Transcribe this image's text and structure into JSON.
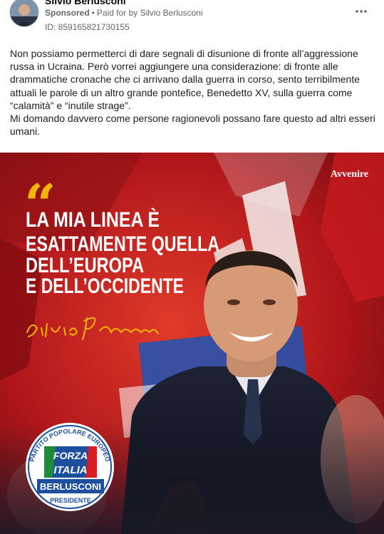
{
  "post": {
    "page_name": "Silvio Berlusconi",
    "sponsored_label": "Sponsored",
    "separator": "•",
    "paid_for_text": "Paid for by Silvio Berlusconi",
    "ad_id": "ID: 859165821730155",
    "more_icon": "more-horizontal-icon",
    "body_paragraphs": [
      "Non possiamo permetterci di dare segnali di disunione di fronte all’aggressione russa in Ucraina. Però vorrei aggiungere una considerazione: di fronte alle drammatiche cronache che ci arrivano dalla guerra in corso, sento terribilmente attuali le parole di un altro grande pontefice, Benedetto XV, sulla guerra come “calamità” e “inutile strage”.",
      "Mi domando davvero come persone ragionevoli possano fare questo ad altri esseri umani."
    ]
  },
  "creative": {
    "watermark": "Avvenire",
    "quote_mark": "“",
    "headline_lines": [
      "LA MIA LINEA È",
      "ESATTAMENTE QUELLA",
      "DELL’EUROPA",
      "E DELL’OCCIDENTE"
    ],
    "logo": {
      "ring_text": "PARTITO POPOLARE EUROPEO",
      "party_line_1": "FORZA",
      "party_line_2": "ITALIA",
      "leader": "BERLUSCONI",
      "role": "PRESIDENTE"
    },
    "signature_text": "Silvio Berlusconi",
    "colors": {
      "quote_yellow": "#f2b705",
      "headline_white": "#ffffff",
      "logo_blue": "#1d4f9e",
      "flag_green": "#1e8a3c",
      "flag_red": "#d81e25"
    }
  }
}
